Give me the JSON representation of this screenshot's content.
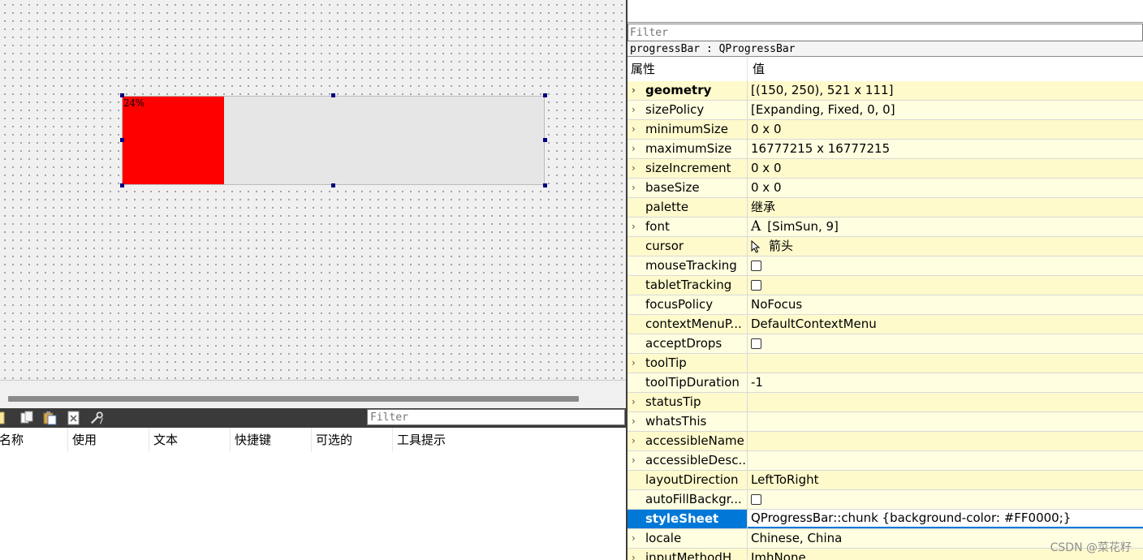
{
  "designer": {
    "progress_bar": {
      "value_percent": 24,
      "text": "24%",
      "chunk_color": "#FF0000"
    }
  },
  "action_editor": {
    "filter_placeholder": "Filter",
    "toolbar_icons": [
      "new-action-icon",
      "copy-action-icon",
      "paste-action-icon",
      "delete-action-icon",
      "configure-icon"
    ],
    "columns": [
      "名称",
      "使用",
      "文本",
      "快捷键",
      "可选的",
      "工具提示"
    ]
  },
  "property_editor": {
    "filter_placeholder": "Filter",
    "object_label": "progressBar : QProgressBar",
    "header": {
      "name": "属性",
      "value": "值"
    },
    "rows": [
      {
        "name": "geometry",
        "value": "[(150, 250), 521 x 111]",
        "expand": true,
        "bold": true,
        "shade": "deep"
      },
      {
        "name": "sizePolicy",
        "value": "[Expanding, Fixed, 0, 0]",
        "expand": true,
        "shade": "pale"
      },
      {
        "name": "minimumSize",
        "value": "0 x 0",
        "expand": true,
        "shade": "deep"
      },
      {
        "name": "maximumSize",
        "value": "16777215 x 16777215",
        "expand": true,
        "shade": "pale"
      },
      {
        "name": "sizeIncrement",
        "value": "0 x 0",
        "expand": true,
        "shade": "deep"
      },
      {
        "name": "baseSize",
        "value": "0 x 0",
        "expand": true,
        "shade": "pale"
      },
      {
        "name": "palette",
        "value": "继承",
        "expand": false,
        "shade": "deep"
      },
      {
        "name": "font",
        "value": "[SimSun, 9]",
        "expand": true,
        "icon": "font",
        "shade": "pale"
      },
      {
        "name": "cursor",
        "value": "箭头",
        "expand": false,
        "icon": "cursor",
        "shade": "deep"
      },
      {
        "name": "mouseTracking",
        "value": "",
        "expand": false,
        "checkbox": true,
        "shade": "pale"
      },
      {
        "name": "tabletTracking",
        "value": "",
        "expand": false,
        "checkbox": true,
        "shade": "deep"
      },
      {
        "name": "focusPolicy",
        "value": "NoFocus",
        "expand": false,
        "shade": "pale"
      },
      {
        "name": "contextMenuP...",
        "value": "DefaultContextMenu",
        "expand": false,
        "shade": "deep"
      },
      {
        "name": "acceptDrops",
        "value": "",
        "expand": false,
        "checkbox": true,
        "shade": "pale"
      },
      {
        "name": "toolTip",
        "value": "",
        "expand": true,
        "shade": "deep"
      },
      {
        "name": "toolTipDuration",
        "value": "-1",
        "expand": false,
        "shade": "pale"
      },
      {
        "name": "statusTip",
        "value": "",
        "expand": true,
        "shade": "deep"
      },
      {
        "name": "whatsThis",
        "value": "",
        "expand": true,
        "shade": "pale"
      },
      {
        "name": "accessibleName",
        "value": "",
        "expand": true,
        "shade": "deep"
      },
      {
        "name": "accessibleDesc...",
        "value": "",
        "expand": true,
        "shade": "pale"
      },
      {
        "name": "layoutDirection",
        "value": "LeftToRight",
        "expand": false,
        "shade": "deep"
      },
      {
        "name": "autoFillBackgr...",
        "value": "",
        "expand": false,
        "checkbox": true,
        "shade": "pale"
      },
      {
        "name": "styleSheet",
        "value": "QProgressBar::chunk {background-color: #FF0000;}",
        "expand": false,
        "selected": true,
        "shade": "deep"
      },
      {
        "name": "locale",
        "value": "Chinese, China",
        "expand": true,
        "shade": "pale"
      },
      {
        "name": "inputMethodH...",
        "value": "ImhNone",
        "expand": true,
        "shade": "deep"
      }
    ]
  },
  "watermark": "CSDN @菜花籽"
}
